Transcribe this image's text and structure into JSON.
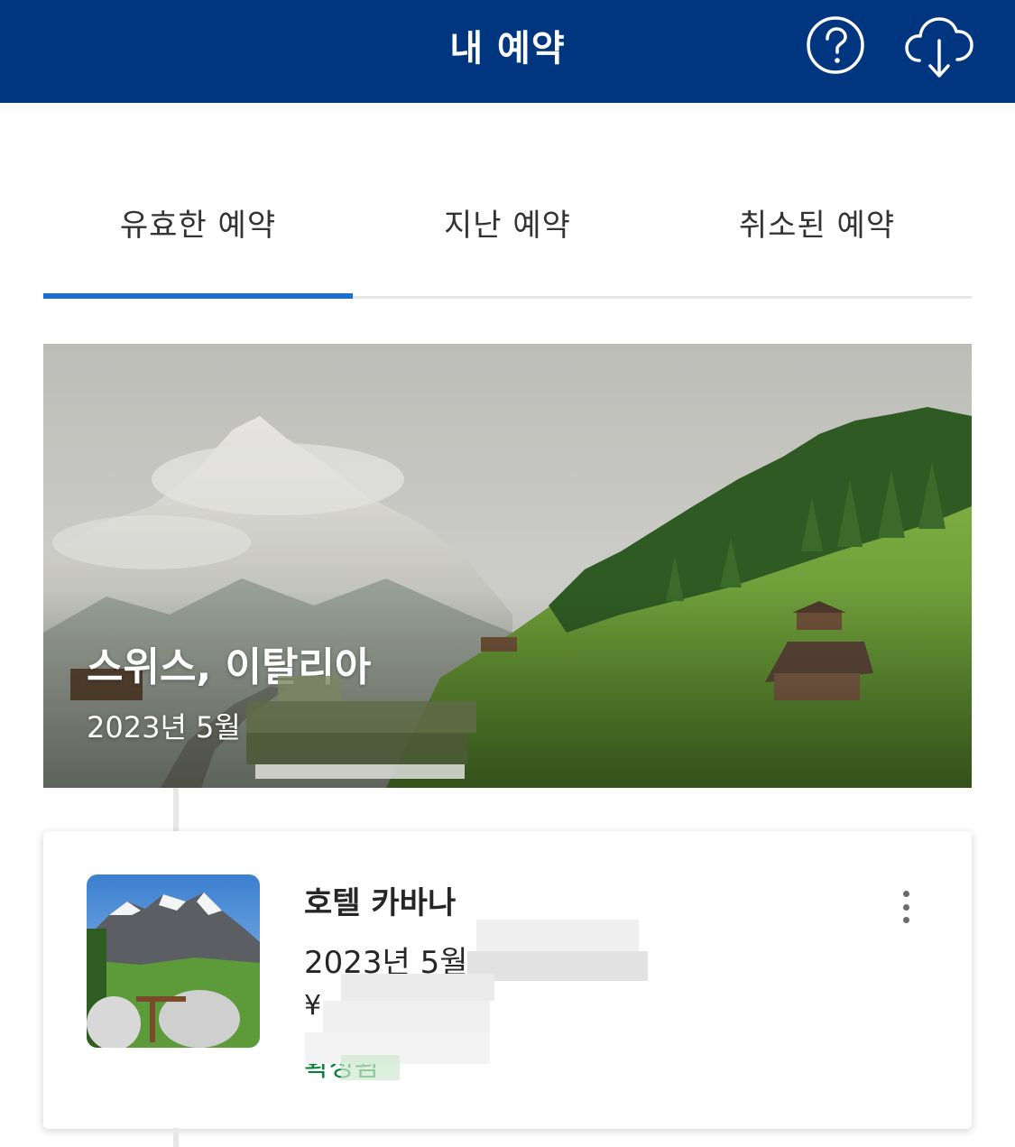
{
  "header": {
    "title": "내 예약",
    "help_icon": "question-circle-icon",
    "download_icon": "cloud-download-icon",
    "background": "#003580"
  },
  "tabs": [
    {
      "label": "유효한 예약",
      "active": true
    },
    {
      "label": "지난 예약",
      "active": false
    },
    {
      "label": "취소된 예약",
      "active": false
    }
  ],
  "trip": {
    "title": "스위스, 이탈리아",
    "dates": "2023년 5월"
  },
  "booking": {
    "hotel_name": "호텔 카바나",
    "dates": "2023년 5월",
    "price": "¥",
    "status": "확정됨",
    "status_color": "#008234",
    "menu_icon": "more-vertical-icon"
  },
  "colors": {
    "accent": "#1a6ed0",
    "brand": "#003580"
  }
}
